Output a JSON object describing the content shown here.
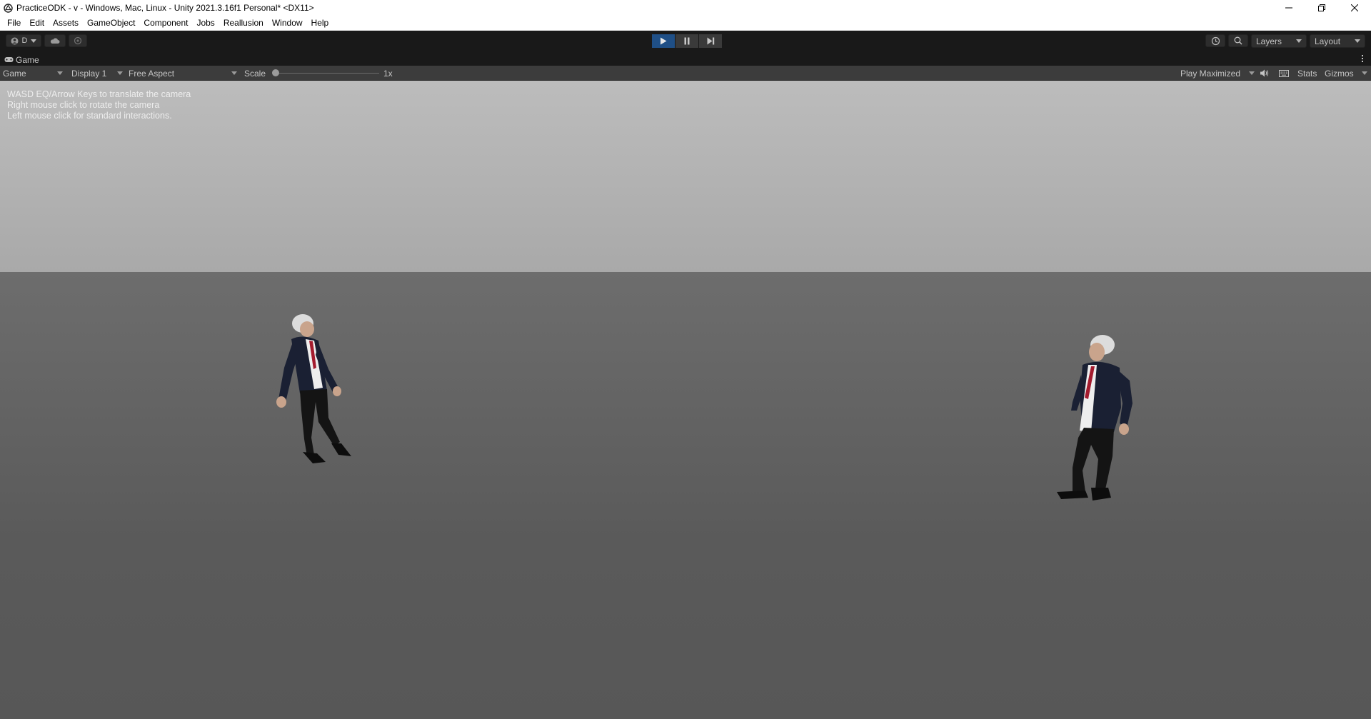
{
  "window": {
    "title": "PracticeODK - v - Windows, Mac, Linux - Unity 2021.3.16f1 Personal* <DX11>"
  },
  "menu": [
    "File",
    "Edit",
    "Assets",
    "GameObject",
    "Component",
    "Jobs",
    "Reallusion",
    "Window",
    "Help"
  ],
  "toolbar": {
    "account_label": "D",
    "layers_label": "Layers",
    "layout_label": "Layout"
  },
  "tab": {
    "label": "Game"
  },
  "gamebar": {
    "mode": "Game",
    "display": "Display 1",
    "aspect": "Free Aspect",
    "scale_label": "Scale",
    "scale_value": "1x",
    "scale_fraction": 0.0,
    "play_mode": "Play Maximized",
    "stats": "Stats",
    "gizmos": "Gizmos"
  },
  "viewport": {
    "hint_lines": [
      "WASD EQ/Arrow Keys to translate the camera",
      "Right mouse click to rotate the camera",
      "Left mouse click for standard interactions."
    ]
  },
  "colors": {
    "play_active": "#1f4f86",
    "sky": "#aeaeae",
    "ground": "#5e5e5e",
    "suit": "#1a2033",
    "tie": "#a31b2e"
  }
}
